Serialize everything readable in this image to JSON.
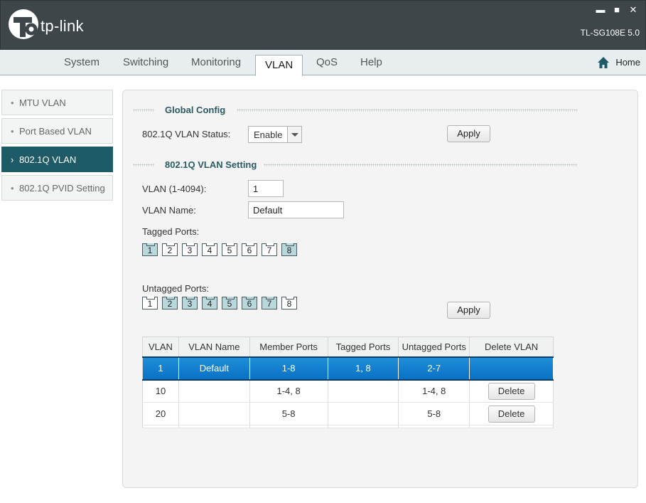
{
  "header": {
    "logo_text": "tp-link",
    "model": "TL-SG108E 5.0",
    "minimize": "▬",
    "maximize": "■",
    "close": "✕"
  },
  "tabs": [
    {
      "label": "System"
    },
    {
      "label": "Switching"
    },
    {
      "label": "Monitoring"
    },
    {
      "label": "VLAN",
      "active": true
    },
    {
      "label": "QoS"
    },
    {
      "label": "Help"
    }
  ],
  "home_label": "Home",
  "sidebar": {
    "items": [
      {
        "label": "MTU VLAN",
        "mark": "•"
      },
      {
        "label": "Port Based VLAN",
        "mark": "•"
      },
      {
        "label": "802.1Q VLAN",
        "mark": "›",
        "active": true
      },
      {
        "label": "802.1Q PVID Setting",
        "mark": "•"
      }
    ]
  },
  "global_config": {
    "title": "Global Config",
    "status_label": "802.1Q VLAN Status:",
    "status_value": "Enable",
    "apply_label": "Apply"
  },
  "vlan_setting": {
    "title": "802.1Q VLAN Setting",
    "vlan_id_label": "VLAN (1-4094):",
    "vlan_id_value": "1",
    "vlan_name_label": "VLAN Name:",
    "vlan_name_value": "Default",
    "tagged_label": "Tagged Ports:",
    "untagged_label": "Untagged Ports:",
    "tagged_ports": [
      {
        "n": "1",
        "sel": true
      },
      {
        "n": "2",
        "sel": false
      },
      {
        "n": "3",
        "sel": false
      },
      {
        "n": "4",
        "sel": false
      },
      {
        "n": "5",
        "sel": false
      },
      {
        "n": "6",
        "sel": false
      },
      {
        "n": "7",
        "sel": false
      },
      {
        "n": "8",
        "sel": true
      }
    ],
    "untagged_ports": [
      {
        "n": "1",
        "sel": false
      },
      {
        "n": "2",
        "sel": true
      },
      {
        "n": "3",
        "sel": true
      },
      {
        "n": "4",
        "sel": true
      },
      {
        "n": "5",
        "sel": true
      },
      {
        "n": "6",
        "sel": true
      },
      {
        "n": "7",
        "sel": true
      },
      {
        "n": "8",
        "sel": false
      }
    ],
    "apply_label": "Apply"
  },
  "table": {
    "headers": [
      "VLAN",
      "VLAN Name",
      "Member Ports",
      "Tagged Ports",
      "Untagged Ports",
      "Delete VLAN"
    ],
    "rows": [
      {
        "vlan": "1",
        "name": "Default",
        "members": "1-8",
        "tagged": "1, 8",
        "untagged": "2-7",
        "delete": "",
        "selected": true
      },
      {
        "vlan": "10",
        "name": "",
        "members": "1-4, 8",
        "tagged": "",
        "untagged": "1-4, 8",
        "delete": "Delete",
        "selected": false
      },
      {
        "vlan": "20",
        "name": "",
        "members": "5-8",
        "tagged": "",
        "untagged": "5-8",
        "delete": "Delete",
        "selected": false
      },
      {
        "vlan": "",
        "name": "",
        "members": "",
        "tagged": "",
        "untagged": "",
        "delete": "",
        "selected": false
      }
    ]
  },
  "colors": {
    "header_bg": "#3e4649",
    "sidebar_active": "#1f5b66",
    "selected_row": "#0a70c4",
    "port_selected": "#b9d8dc"
  }
}
